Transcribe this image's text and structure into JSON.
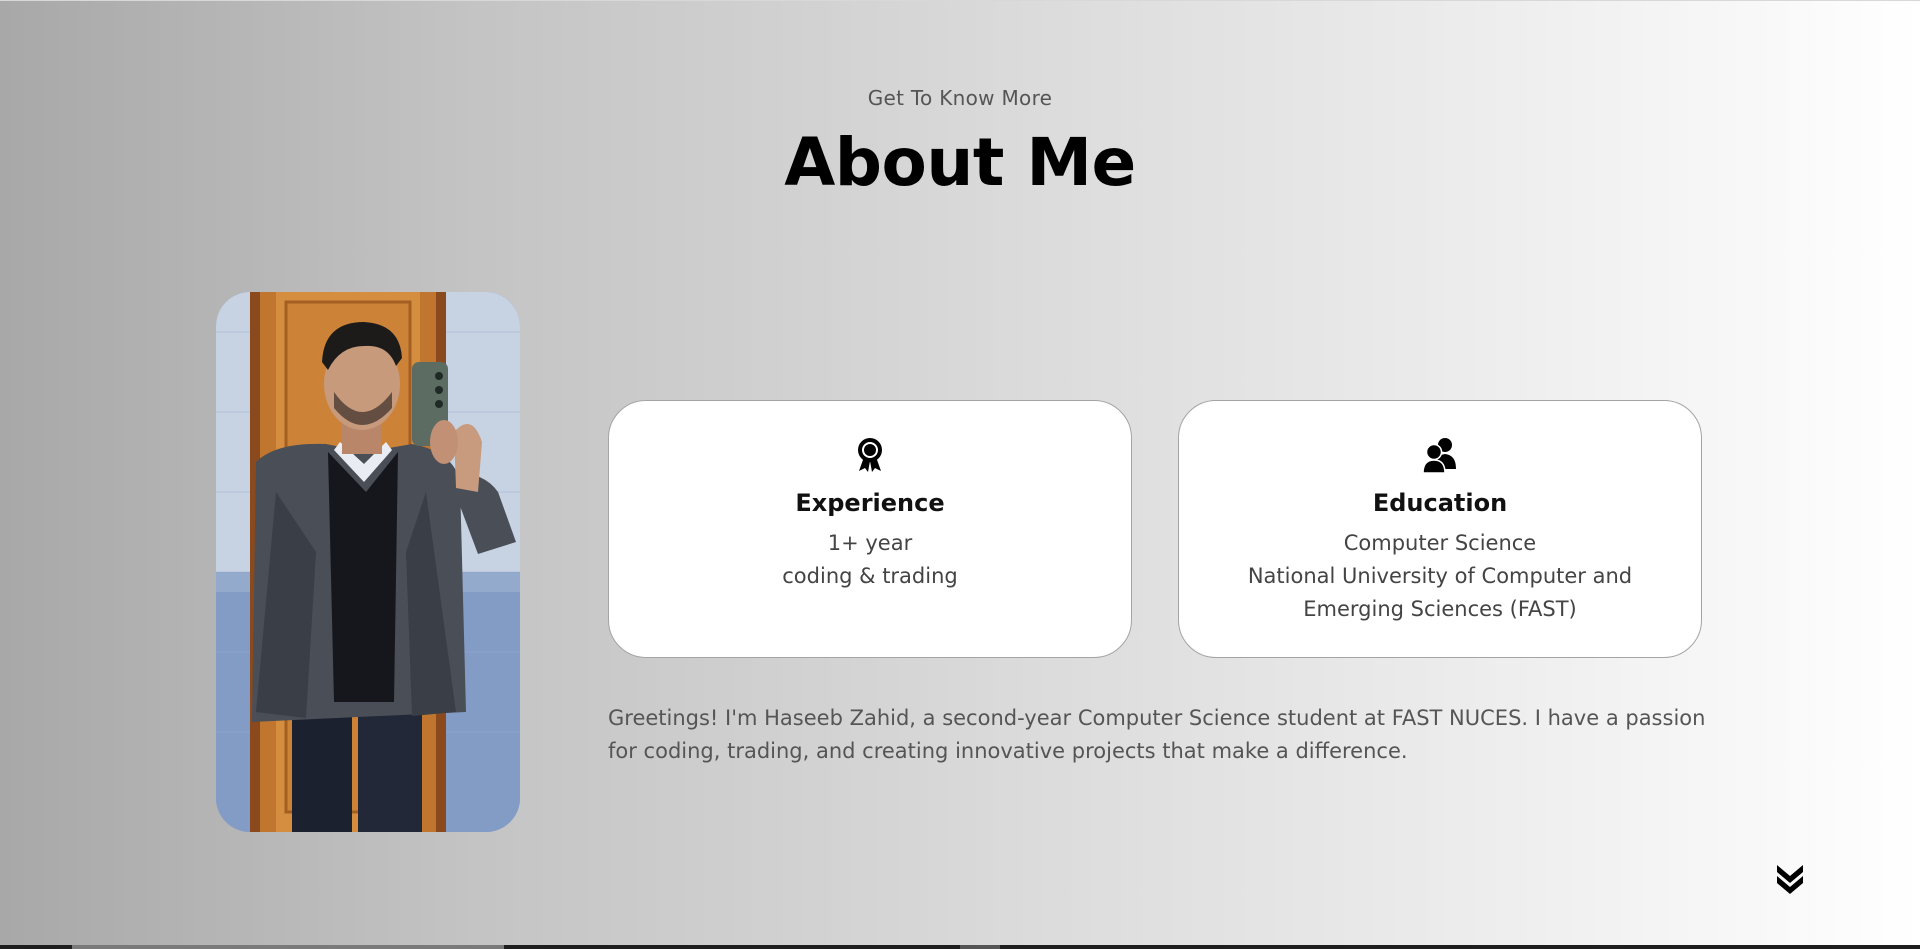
{
  "about": {
    "subtitle": "Get To Know More",
    "title": "About Me"
  },
  "profile_photo": {
    "icon": "profile-picture"
  },
  "cards": {
    "experience": {
      "icon": "award-ribbon-icon",
      "title": "Experience",
      "lines": [
        "1+ year",
        "coding & trading"
      ]
    },
    "education": {
      "icon": "users-icon",
      "title": "Education",
      "lines": [
        "Computer Science",
        "National University of Computer and",
        "Emerging Sciences (FAST)"
      ]
    }
  },
  "greeting": "Greetings! I'm Haseeb Zahid, a second-year Computer Science student at FAST NUCES. I have a passion for coding, trading, and creating innovative projects that make a difference.",
  "scroll_arrow": {
    "icon": "double-chevron-down-icon"
  },
  "colors": {
    "card_bg": "#ffffff",
    "card_border": "#a4a4a4",
    "title": "#000000",
    "muted_text": "#555555"
  }
}
